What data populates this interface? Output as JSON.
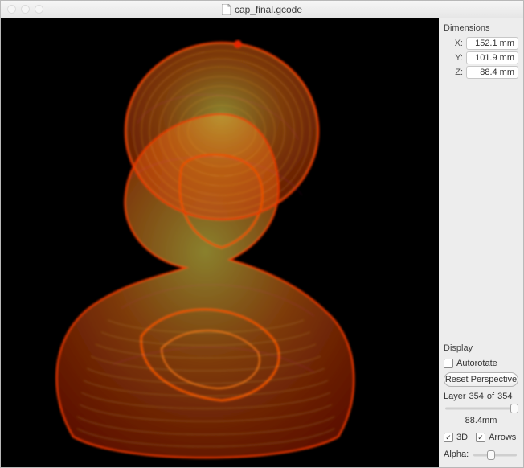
{
  "window": {
    "filename": "cap_final.gcode"
  },
  "dimensions": {
    "title": "Dimensions",
    "x_label": "X:",
    "y_label": "Y:",
    "z_label": "Z:",
    "x_value": "152.1 mm",
    "y_value": "101.9 mm",
    "z_value": "88.4 mm"
  },
  "display": {
    "title": "Display",
    "autorotate_label": "Autorotate",
    "autorotate_checked": false,
    "reset_button": "Reset Perspective",
    "layer_label": "Layer",
    "layer_current": "354",
    "layer_of": "of",
    "layer_total": "354",
    "layer_mm": "88.4mm",
    "threeD_label": "3D",
    "threeD_checked": true,
    "arrows_label": "Arrows",
    "arrows_checked": true,
    "alpha_label": "Alpha:",
    "layer_slider_pos": 1.0,
    "alpha_slider_pos": 0.4
  }
}
